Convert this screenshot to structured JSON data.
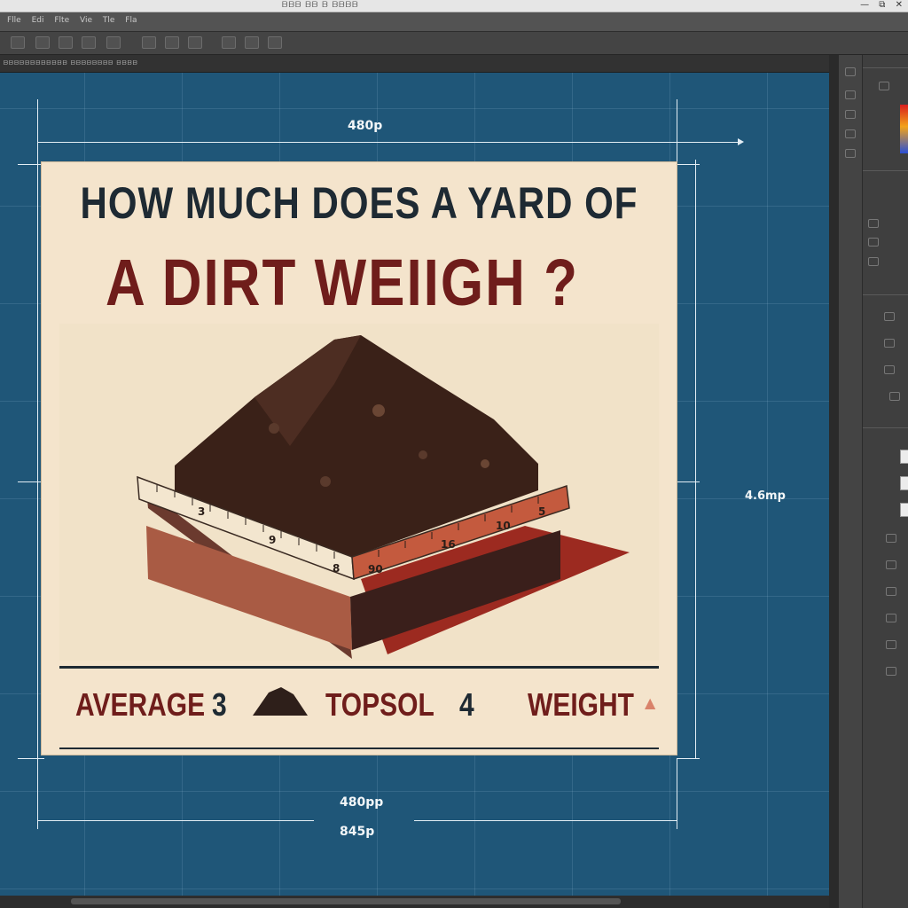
{
  "window": {
    "menu_text": "ᗷᗷᗷ ᗷᗷ ᗷ  ᗷᗷᗷᗷ",
    "window_controls": [
      "—",
      "⧉",
      "✕"
    ]
  },
  "menubar": {
    "items": [
      "Flle",
      "Edi",
      "Flte",
      "Vie",
      "Tle",
      "Fla"
    ]
  },
  "document_tab": {
    "label": "ᗷᗷᗷᗷᗷᗷᗷᗷᗷᗷᗷᗷ ᗷᗷᗷᗷᗷᗷᗷᗷ ᗷᗷᗷᗷ"
  },
  "dimensions": {
    "top_width": "480p",
    "right_height": "4.6mp",
    "bottom_width_1": "480pp",
    "bottom_width_2": "845p"
  },
  "poster": {
    "title_line1": "HOW MUCH DOES A YARD OF",
    "title_line2": "A DIRT WEIIGH ?",
    "footer": {
      "average": "AVERAGE",
      "num_3": "3",
      "topsoil": "TOPSOL",
      "num_4": "4",
      "weight": "WEIGHT"
    },
    "ruler_marks": [
      "3",
      "9",
      "8",
      "90",
      "16",
      "10",
      "5"
    ]
  },
  "colors": {
    "canvas": "#1f5678",
    "poster_bg": "#f4e4cc",
    "title_dark": "#1e2a33",
    "title_red": "#6f1d1b",
    "soil": "#3a2118",
    "box_red": "#b8493a"
  }
}
